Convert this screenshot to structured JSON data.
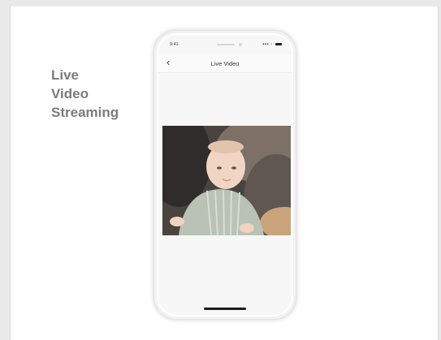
{
  "headline": [
    "Live",
    "Video",
    "Streaming"
  ],
  "status_bar": {
    "time": "9:41",
    "icons": "signal-wifi-battery"
  },
  "navbar": {
    "back_icon": "‹",
    "title": "Live Video"
  },
  "video": {
    "subject": "baby-lying-next-to-dog"
  }
}
